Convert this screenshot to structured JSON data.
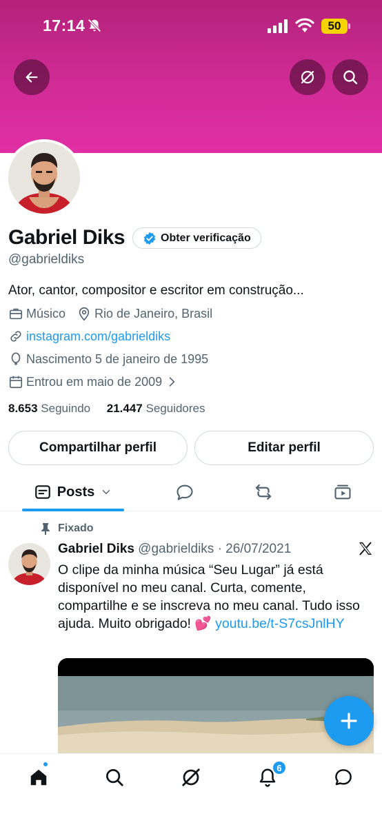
{
  "status_bar": {
    "time": "17:14",
    "battery": "50"
  },
  "profile": {
    "name": "Gabriel Diks",
    "verify_label": "Obter verificação",
    "handle": "@gabrieldiks",
    "bio": "Ator, cantor, compositor e escritor em construção...",
    "category": "Músico",
    "location": "Rio de Janeiro, Brasil",
    "website": "instagram.com/gabrieldiks",
    "birth": "Nascimento 5 de janeiro de 1995",
    "joined": "Entrou em maio de 2009",
    "following_count": "8.653",
    "following_label": "Seguindo",
    "followers_count": "21.447",
    "followers_label": "Seguidores"
  },
  "actions": {
    "share": "Compartilhar perfil",
    "edit": "Editar perfil"
  },
  "tabs": {
    "posts": "Posts"
  },
  "pinned_post": {
    "pinned_label": "Fixado",
    "author": "Gabriel Diks",
    "meta": "@gabrieldiks · 26/07/2021",
    "text": "O clipe da minha música “Seu Lugar” já está disponível no meu canal. Curta, comente, compartilhe e se inscreva no meu canal. Tudo isso ajuda. Muito obrigado! 💕 ",
    "link": "youtu.be/t-S7csJnlHY"
  },
  "bottom_nav": {
    "notifications_badge": "6"
  },
  "colors": {
    "accent": "#1d9bf0",
    "banner": "#d12b96"
  }
}
